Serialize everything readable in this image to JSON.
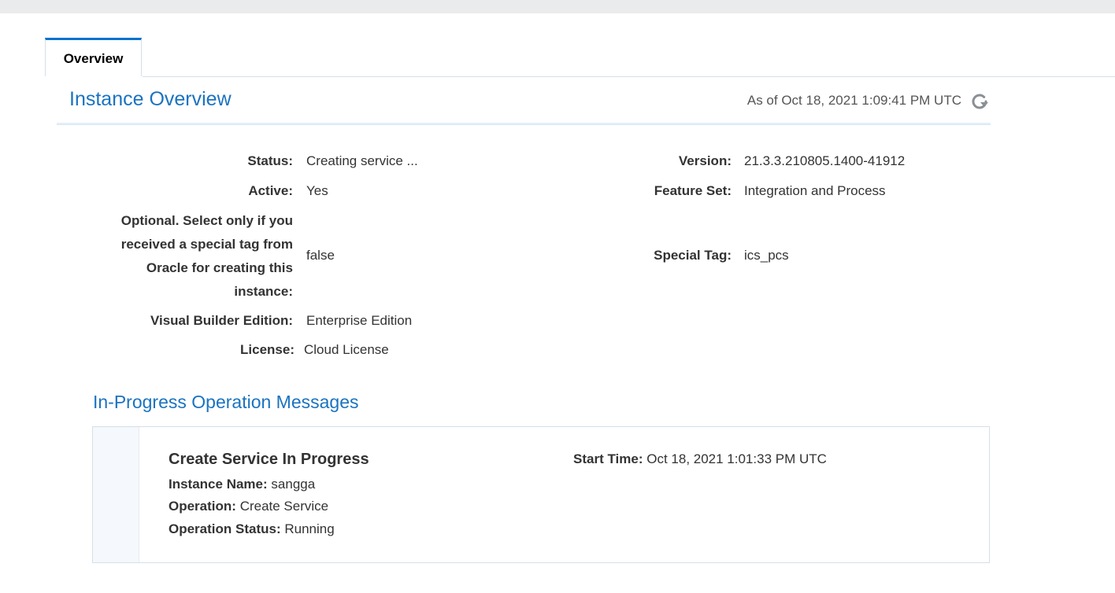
{
  "tabs": [
    {
      "label": "Overview",
      "active": true
    }
  ],
  "header": {
    "title": "Instance Overview",
    "as_of": "As of Oct 18, 2021 1:09:41 PM UTC",
    "refresh_icon": "refresh-icon"
  },
  "details": {
    "status_label": "Status:",
    "status_value": "Creating service ...",
    "active_label": "Active:",
    "active_value": "Yes",
    "optional_label": "Optional. Select only if you received a special tag from Oracle for creating this instance:",
    "optional_value": "false",
    "vb_label": "Visual Builder Edition:",
    "vb_value": "Enterprise Edition",
    "license_label": "License:",
    "license_value": "Cloud License",
    "version_label": "Version:",
    "version_value": "21.3.3.210805.1400-41912",
    "feature_label": "Feature Set:",
    "feature_value": "Integration and Process",
    "special_label": "Special Tag:",
    "special_value": "ics_pcs"
  },
  "operations": {
    "title": "In-Progress Operation Messages",
    "message": {
      "title": "Create Service In Progress",
      "instance_label": "Instance Name:",
      "instance_value": "sangga",
      "operation_label": "Operation:",
      "operation_value": "Create Service",
      "op_status_label": "Operation Status:",
      "op_status_value": "Running",
      "start_label": "Start Time:",
      "start_value": "Oct 18, 2021 1:01:33 PM UTC"
    }
  },
  "colors": {
    "accent": "#0572ce",
    "heading": "#1a73c0"
  }
}
